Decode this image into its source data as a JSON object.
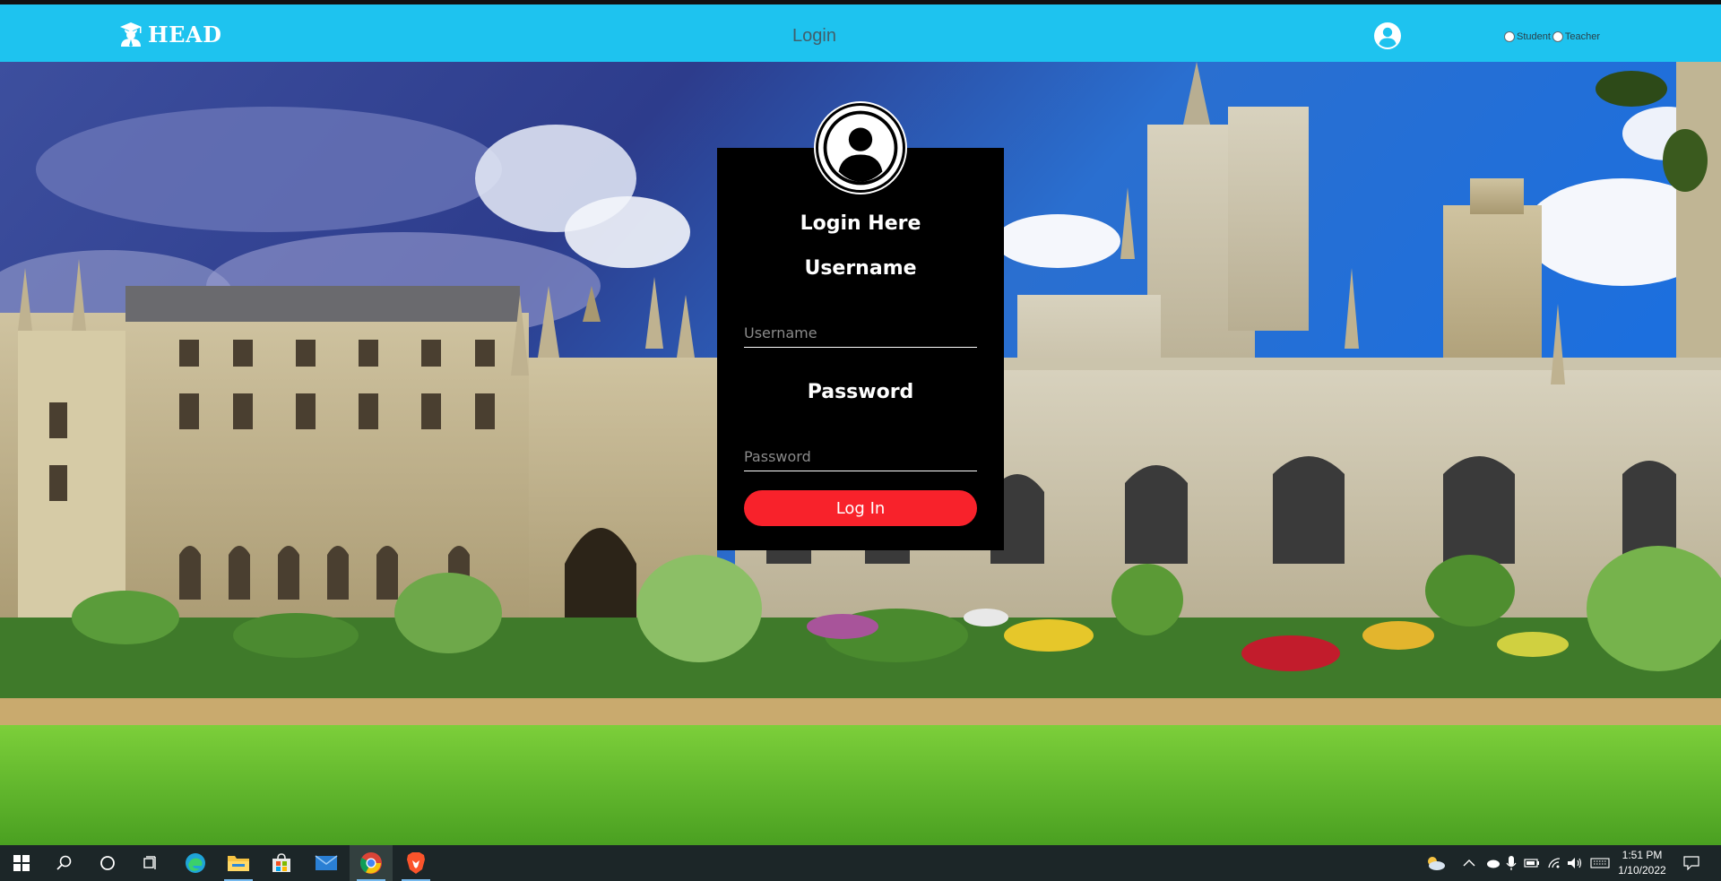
{
  "header": {
    "brand": "HEAD",
    "page_title": "Login",
    "roles": [
      {
        "label": "Student",
        "selected": false
      },
      {
        "label": "Teacher",
        "selected": false
      }
    ],
    "accent_color": "#1ec3ef"
  },
  "login_card": {
    "title": "Login Here",
    "username_label": "Username",
    "username_placeholder": "Username",
    "username_value": "",
    "password_label": "Password",
    "password_placeholder": "Password",
    "password_value": "",
    "submit_label": "Log In",
    "button_color": "#f8222b"
  },
  "taskbar": {
    "pinned": [
      "start-icon",
      "search-icon",
      "cortana-icon",
      "task-view-icon",
      "edge-icon",
      "file-explorer-icon",
      "store-icon",
      "mail-icon",
      "chrome-icon",
      "brave-icon"
    ],
    "clock_time": "1:51 PM",
    "clock_date": "1/10/2022"
  }
}
